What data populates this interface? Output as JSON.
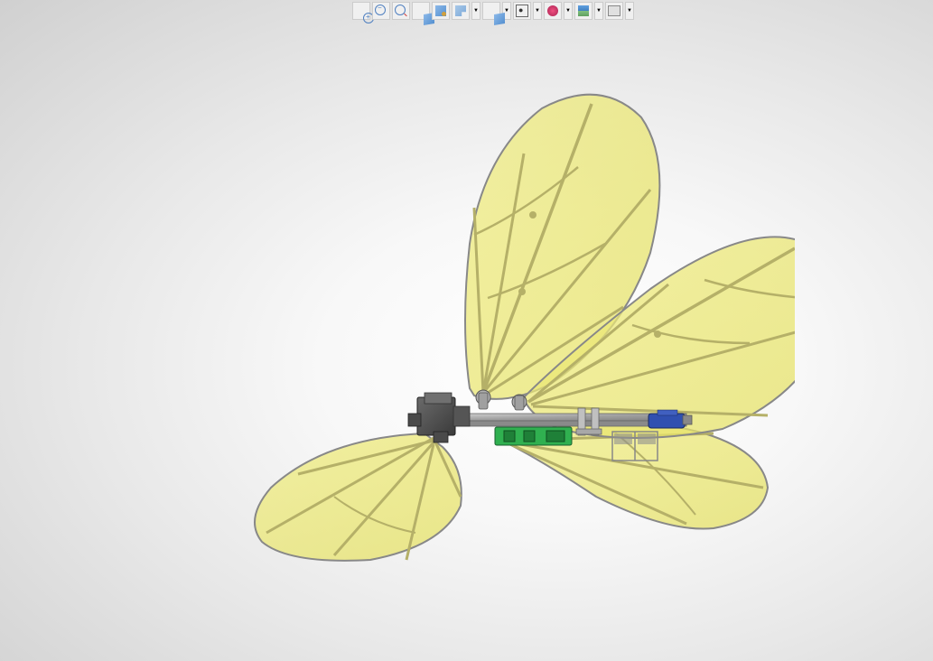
{
  "toolbar": {
    "buttons": [
      {
        "name": "zoom-to-fit",
        "icon": "zoom-in"
      },
      {
        "name": "zoom-area",
        "icon": "zoom-out"
      },
      {
        "name": "previous-view",
        "icon": "zoom-fit"
      },
      {
        "name": "section-view",
        "icon": "box",
        "hasDropdown": true
      },
      {
        "name": "view-orientation",
        "icon": "display",
        "hasDropdown": true
      },
      {
        "name": "display-style",
        "icon": "section",
        "hasDropdown": true
      },
      {
        "name": "hide-show",
        "icon": "box",
        "hasDropdown": true
      },
      {
        "name": "edit-appearance",
        "icon": "view1",
        "hasDropdown": true
      },
      {
        "name": "apply-scene",
        "icon": "appearance",
        "hasDropdown": true
      },
      {
        "name": "view-settings",
        "icon": "scene",
        "hasDropdown": true
      },
      {
        "name": "render-tools",
        "icon": "render",
        "hasDropdown": true
      }
    ]
  },
  "model": {
    "description": "butterfly-ornithopter-assembly",
    "wing_color": "#ece977",
    "wing_opacity": "0.72",
    "frame_color": "#9a9a9a",
    "body_color": "#5a5a5a",
    "pcb_color": "#30b050",
    "motor_color": "#3050b0"
  }
}
